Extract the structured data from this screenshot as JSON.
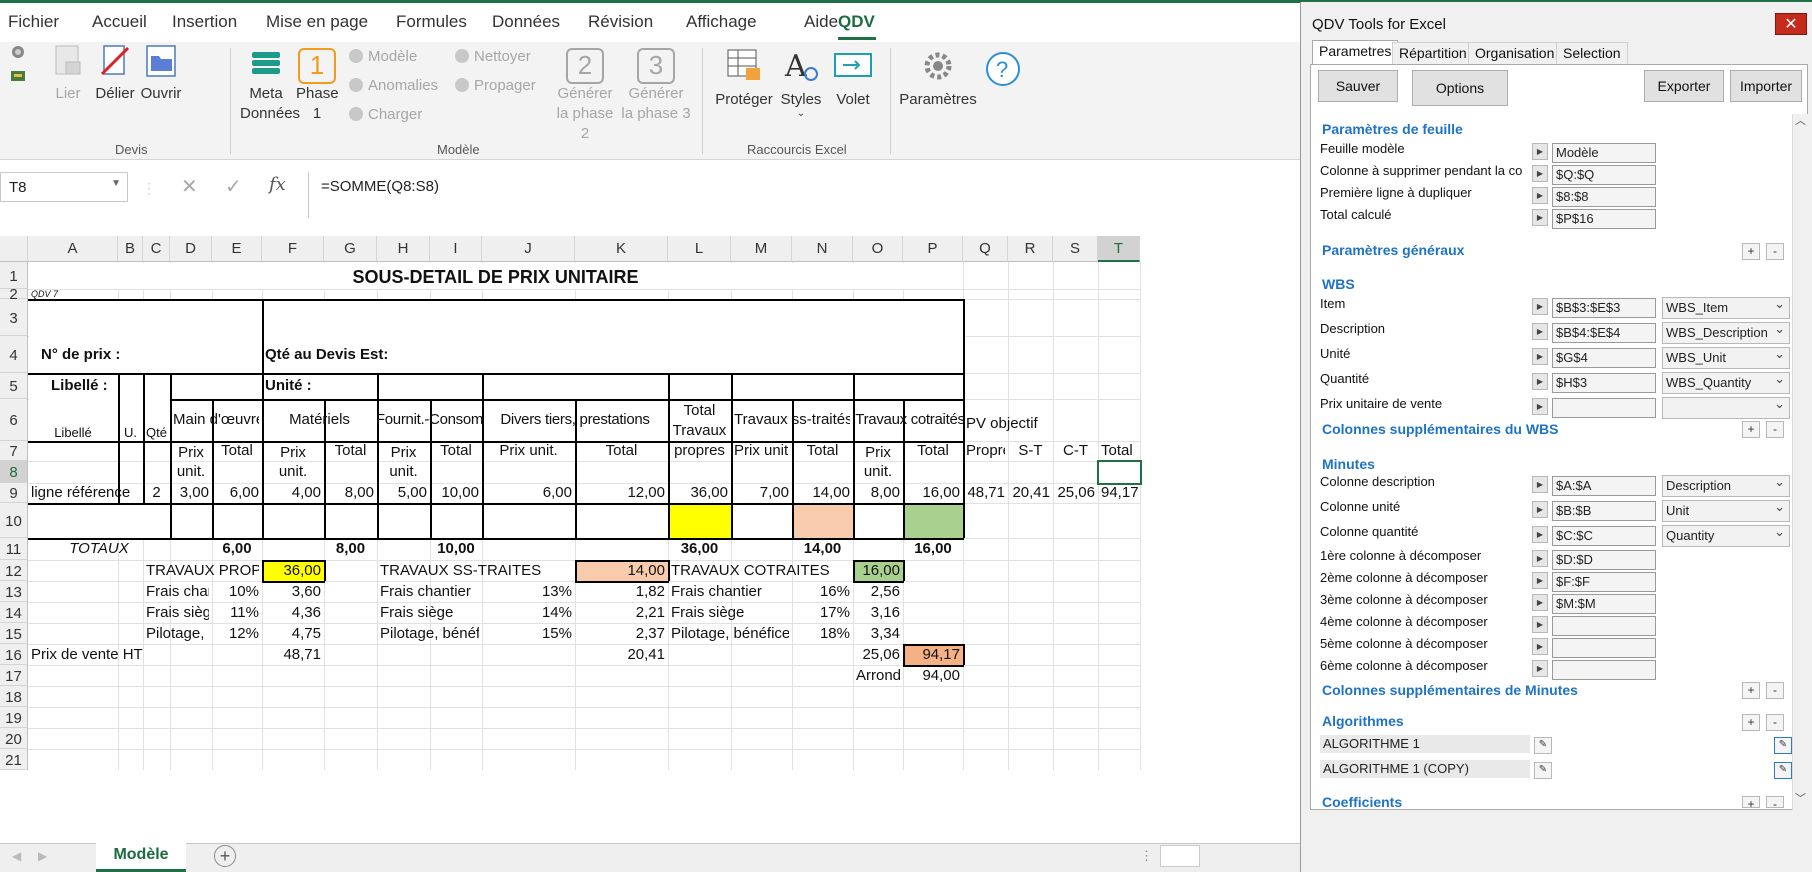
{
  "ribbon_tabs": [
    "Fichier",
    "Accueil",
    "Insertion",
    "Mise en page",
    "Formules",
    "Données",
    "Révision",
    "Affichage",
    "Aide",
    "QDV"
  ],
  "ribbon": {
    "devis": {
      "lier": "Lier",
      "delier": "Délier",
      "ouvrir": "Ouvrir",
      "group": "Devis"
    },
    "modele": {
      "meta1": "Meta",
      "meta2": "Données",
      "phase": "Phase",
      "phase_num": "1",
      "phase_sub": "1",
      "modele": "Modèle",
      "anomalies": "Anomalies",
      "charger": "Charger",
      "nettoyer": "Nettoyer",
      "propager": "Propager",
      "gen2_num": "2",
      "gen2a": "Générer",
      "gen2b": "la phase 2",
      "gen3_num": "3",
      "gen3a": "Générer",
      "gen3b": "la phase 3",
      "group": "Modèle"
    },
    "raccourcis": {
      "proteger": "Protéger",
      "styles": "Styles",
      "volet": "Volet",
      "group": "Raccourcis Excel"
    },
    "parametres": "Paramètres"
  },
  "name_box": "T8",
  "formula": "=SOMME(Q8:S8)",
  "columns": [
    "A",
    "B",
    "C",
    "D",
    "E",
    "F",
    "G",
    "H",
    "I",
    "J",
    "K",
    "L",
    "M",
    "N",
    "O",
    "P",
    "Q",
    "R",
    "S",
    "T"
  ],
  "rows": [
    "1",
    "2",
    "3",
    "4",
    "5",
    "6",
    "7",
    "8",
    "9",
    "10",
    "11",
    "12",
    "13",
    "14",
    "15",
    "16",
    "17",
    "18",
    "19",
    "20",
    "21"
  ],
  "sheet": {
    "title": "SOUS-DETAIL DE PRIX UNITAIRE",
    "qdv_version": "QDV 7",
    "num_prix": "N° de prix :",
    "qte_devis": "Qté au Devis Est:",
    "libelle_label": "Libellé :",
    "unite_label": "Unité :",
    "h_libelle": "Libellé",
    "h_u": "U.",
    "h_qte": "Qté",
    "h_main": "Main d'œuvre",
    "h_mat": "Matériels",
    "h_fourn": "Fournit.-Consom",
    "h_divers": "Divers tiers, prestations",
    "h_total_tp1": "Total",
    "h_total_tp2": "Travaux",
    "h_total_tp3": "propres",
    "h_ss": "Travaux ss-traités",
    "h_cot": "Travaux cotraités",
    "h_pv": "PV objectif",
    "h_prix1": "Prix",
    "h_prix2": "unit.",
    "h_prixunit": "Prix unit.",
    "h_total": "Total",
    "h_propre": "Propre",
    "h_st": "S-T",
    "h_ct": "C-T",
    "row8": {
      "lib": "ligne référence",
      "qte": "2",
      "d": "3,00",
      "e": "6,00",
      "f": "4,00",
      "g": "8,00",
      "h": "5,00",
      "i": "10,00",
      "j": "6,00",
      "k": "12,00",
      "l": "36,00",
      "m": "7,00",
      "n": "14,00",
      "o": "8,00",
      "p": "16,00",
      "q": "48,71",
      "r": "20,41",
      "s": "25,06",
      "t": "94,17"
    },
    "totaux": {
      "label": "TOTAUX",
      "e": "6,00",
      "g": "8,00",
      "i": "10,00",
      "l": "36,00",
      "n": "14,00",
      "p": "16,00"
    },
    "tp": {
      "label": "TRAVAUX PROPRES",
      "val": "36,00"
    },
    "ss": {
      "label": "TRAVAUX SS-TRAITES",
      "val": "14,00"
    },
    "cot": {
      "label": "TRAVAUX COTRAITES",
      "val": "16,00"
    },
    "frais_chantier": "Frais chantier",
    "frais_siege": "Frais siège",
    "pilotage": "Pilotage, bénéfi",
    "pilotage_full": "Pilotage, bénéfice",
    "tp_rows": [
      [
        "10%",
        "3,60"
      ],
      [
        "11%",
        "4,36"
      ],
      [
        "12%",
        "4,75"
      ]
    ],
    "ss_rows": [
      [
        "13%",
        "1,82"
      ],
      [
        "14%",
        "2,21"
      ],
      [
        "15%",
        "2,37"
      ]
    ],
    "cot_rows": [
      [
        "16%",
        "2,56"
      ],
      [
        "17%",
        "3,16"
      ],
      [
        "18%",
        "3,34"
      ]
    ],
    "pv_ht_label": "Prix de vente HT",
    "pv_tp": "48,71",
    "pv_ss": "20,41",
    "pv_cot": "25,06",
    "pv_total": "94,17",
    "arrondi_label": "Arrondi",
    "arrondi_val": "94,00"
  },
  "sheet_tab": "Modèle",
  "pane": {
    "title": "QDV Tools for Excel",
    "close": "✕",
    "tabs": [
      "Parametres",
      "Répartition",
      "Organisation",
      "Selection"
    ],
    "buttons": {
      "sauver": "Sauver",
      "options": "Options",
      "exporter": "Exporter",
      "importer": "Importer"
    },
    "sec_feuille": "Paramètres de feuille",
    "feuille": [
      [
        "Feuille modèle",
        "Modèle"
      ],
      [
        "Colonne à supprimer pendant la co",
        "$Q:$Q"
      ],
      [
        "Première ligne à dupliquer",
        "$8:$8"
      ],
      [
        "Total calculé",
        "$P$16"
      ]
    ],
    "sec_generaux": "Paramètres généraux",
    "sec_wbs": "WBS",
    "wbs": [
      [
        "Item",
        "$B$3:$E$3",
        "WBS_Item"
      ],
      [
        "Description",
        "$B$4:$E$4",
        "WBS_Description"
      ],
      [
        "Unité",
        "$G$4",
        "WBS_Unit"
      ],
      [
        "Quantité",
        "$H$3",
        "WBS_Quantity"
      ],
      [
        "Prix unitaire de vente",
        "",
        ""
      ]
    ],
    "sec_wbs_sup": "Colonnes supplémentaires du WBS",
    "sec_minutes": "Minutes",
    "minutes": [
      [
        "Colonne description",
        "$A:$A",
        "Description"
      ],
      [
        "Colonne unité",
        "$B:$B",
        "Unit"
      ],
      [
        "Colonne quantité",
        "$C:$C",
        "Quantity"
      ]
    ],
    "decomp": [
      [
        "1ère colonne à décomposer",
        "$D:$D"
      ],
      [
        "2ème colonne à décomposer",
        "$F:$F"
      ],
      [
        "3ème colonne à décomposer",
        "$M:$M"
      ],
      [
        "4ème colonne à décomposer",
        ""
      ],
      [
        "5ème colonne à décomposer",
        ""
      ],
      [
        "6ème colonne à décomposer",
        ""
      ]
    ],
    "sec_min_sup": "Colonnes supplémentaires de Minutes",
    "sec_algo": "Algorithmes",
    "algos": [
      "ALGORITHME 1",
      "ALGORITHME 1 (COPY)"
    ],
    "sec_coef": "Coefficients"
  }
}
